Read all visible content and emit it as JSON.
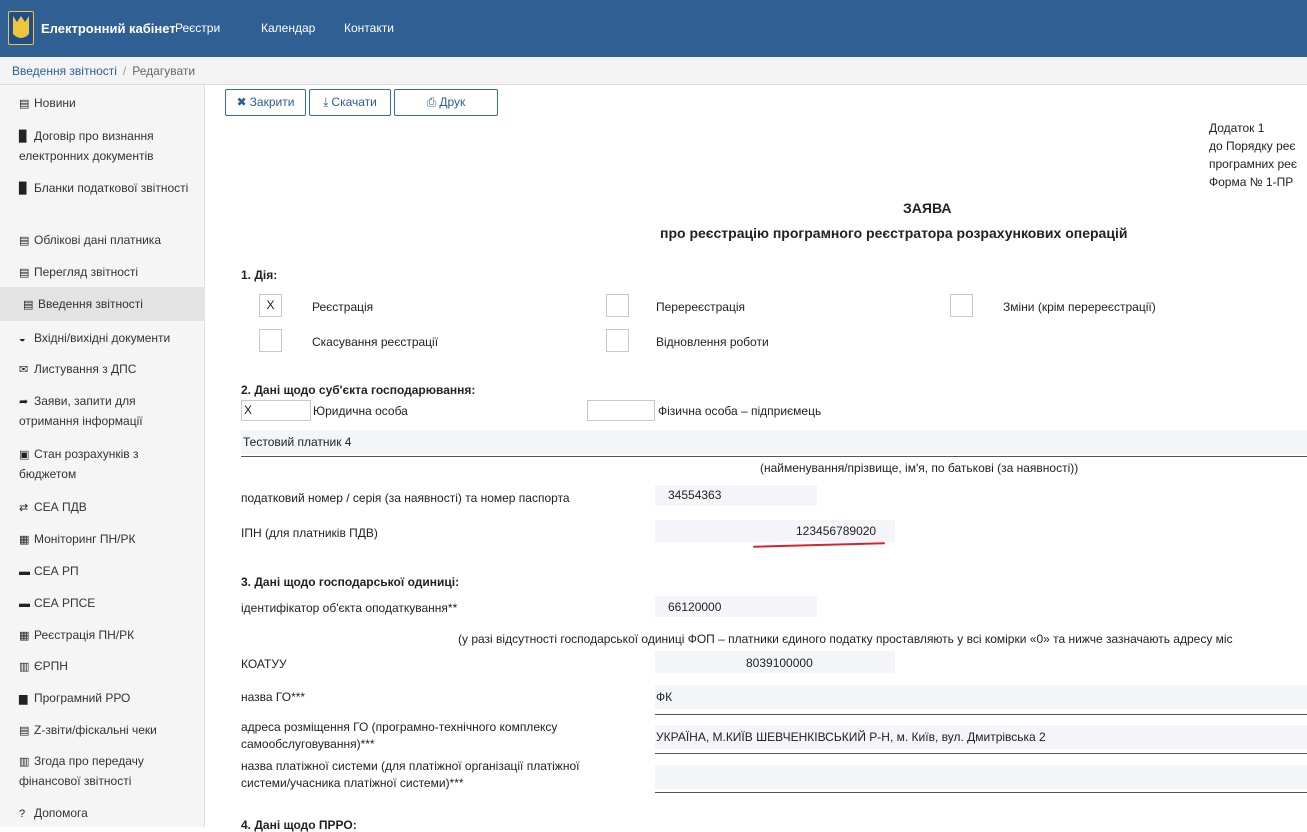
{
  "header": {
    "brand": "Електронний кабінет",
    "nav": [
      "Реєстри",
      "Календар",
      "Контакти"
    ]
  },
  "breadcrumb": {
    "current": "Введення звітності",
    "sep": "/",
    "action": "Редагувати"
  },
  "sidebar": {
    "items": [
      {
        "icon": "newspaper-icon",
        "glyph": "▤",
        "label": "Новини"
      },
      {
        "icon": "document-icon",
        "glyph": "▉",
        "label": "Договір про визнання електронних документів"
      },
      {
        "icon": "forms-icon",
        "glyph": "▉",
        "label": "Бланки податкової звітності"
      },
      {
        "icon": "id-card-icon",
        "glyph": "▤",
        "label": "Облікові дані платника"
      },
      {
        "icon": "file-icon",
        "glyph": "▤",
        "label": "Перегляд звітності"
      },
      {
        "icon": "edit-icon",
        "glyph": "▤",
        "label": "Введення звітності"
      },
      {
        "icon": "inbox-icon",
        "glyph": "◒",
        "label": "Вхідні/вихідні документи"
      },
      {
        "icon": "envelope-icon",
        "glyph": "✉",
        "label": "Листування з ДПС"
      },
      {
        "icon": "share-icon",
        "glyph": "➦",
        "label": "Заяви, запити для отримання інформації"
      },
      {
        "icon": "money-icon",
        "glyph": "▣",
        "label": "Стан розрахунків з бюджетом"
      },
      {
        "icon": "exchange-icon",
        "glyph": "⇄",
        "label": "СЕА ПДВ"
      },
      {
        "icon": "table-icon",
        "glyph": "▦",
        "label": "Моніторинг ПН/РК"
      },
      {
        "icon": "table-icon",
        "glyph": "▬",
        "label": "СЕА РП"
      },
      {
        "icon": "table-icon",
        "glyph": "▬",
        "label": "СЕА РПСЕ"
      },
      {
        "icon": "register-icon",
        "glyph": "▦",
        "label": "Реєстрація ПН/РК"
      },
      {
        "icon": "barcode-icon",
        "glyph": "▥",
        "label": "ЄРПН"
      },
      {
        "icon": "printer-icon",
        "glyph": "▆",
        "label": "Програмний РРО"
      },
      {
        "icon": "list-icon",
        "glyph": "▤",
        "label": "Z-звіти/фіскальні чеки"
      },
      {
        "icon": "bank-icon",
        "glyph": "▥",
        "label": "Згода про передачу фінансової звітності"
      },
      {
        "icon": "help-icon",
        "glyph": "?",
        "label": "Допомога"
      }
    ]
  },
  "toolbar": {
    "close_label": "Закрити",
    "download_label": "Скачати",
    "print_label": "Друк"
  },
  "doc": {
    "annex": [
      "Додаток 1",
      "до Порядку реє",
      "програмних реє",
      "Форма № 1-ПР"
    ],
    "title": "ЗАЯВА",
    "subtitle": "про реєстрацію програмного реєстратора розрахункових операцій",
    "section1": "1. Дія:",
    "actions": [
      {
        "mark": "X",
        "label": "Реєстрація"
      },
      {
        "mark": "",
        "label": "Перереєстрація"
      },
      {
        "mark": "",
        "label": "Зміни (крім перереєстрації)"
      },
      {
        "mark": "",
        "label": "Скасування реєстрації"
      },
      {
        "mark": "",
        "label": "Відновлення роботи"
      }
    ],
    "section2": "2. Дані щодо суб'єкта господарювання:",
    "entity": [
      {
        "mark": "X",
        "label": "Юридична особа"
      },
      {
        "mark": "",
        "label": "Фізична особа – підприємець"
      }
    ],
    "taxpayer_name": "Тестовий платник 4",
    "name_caption": "(найменування/прізвище, ім'я, по батькові (за наявності))",
    "tax_no_label": "податковий номер / серія (за наявності) та номер паспорта",
    "tax_no_value": "34554363",
    "ipn_label": "ІПН (для платників ПДВ)",
    "ipn_value": "123456789020",
    "section3": "3. Дані щодо господарської одиниці:",
    "object_id_label": "ідентифікатор об'єкта оподаткування**",
    "object_id_value": "66120000",
    "fop_note": "(у разі відсутності господарської одиниці ФОП – платники єдиного податку проставляють у всі комірки «0» та нижче зазначають адресу міс",
    "koatuu_label": "КОАТУУ",
    "koatuu_value": "8039100000",
    "go_name_label": "назва ГО***",
    "go_name_value": "ФК",
    "go_address_label": "адреса розміщення ГО (програмно-технічного комплексу самообслуговування)***",
    "go_address_value": "УКРАЇНА, М.КИЇВ ШЕВЧЕНКІВСЬКИЙ Р-Н, м. Київ, вул. Дмитрівська 2",
    "payment_system_label": "назва платіжної системи (для платіжної організації платіжної системи/учасника платіжної системи)***",
    "payment_system_value": "",
    "section4": "4. Дані щодо ПРРО:"
  }
}
